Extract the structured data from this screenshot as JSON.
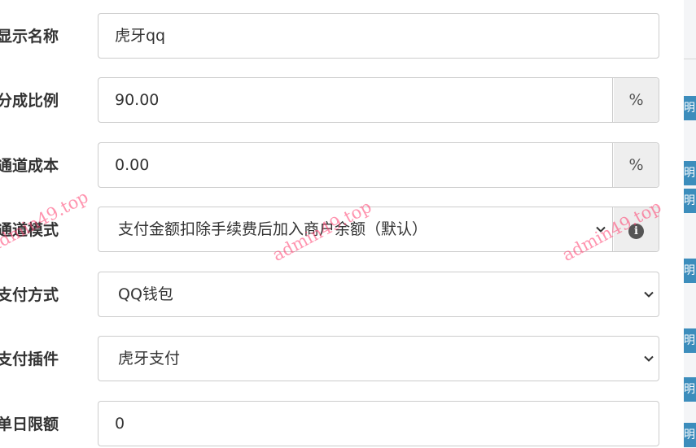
{
  "form": {
    "rows": [
      {
        "label": "显示名称",
        "value": "虎牙qq"
      },
      {
        "label": "分成比例",
        "value": "90.00",
        "addon": "%"
      },
      {
        "label": "通道成本",
        "value": "0.00",
        "addon": "%"
      },
      {
        "label": "通道模式",
        "value": "支付金额扣除手续费后加入商户余额（默认）"
      },
      {
        "label": "支付方式",
        "value": "QQ钱包"
      },
      {
        "label": "支付插件",
        "value": "虎牙支付"
      },
      {
        "label": "单日限额",
        "value": "0"
      }
    ]
  },
  "background": {
    "tab_text": "明"
  },
  "watermark": "admin49.top",
  "colors": {
    "tab_blue": "#3c8dbc",
    "watermark": "#ff3c6e"
  },
  "icons": {
    "info": "info-icon",
    "select": "chevron-down-icon"
  }
}
